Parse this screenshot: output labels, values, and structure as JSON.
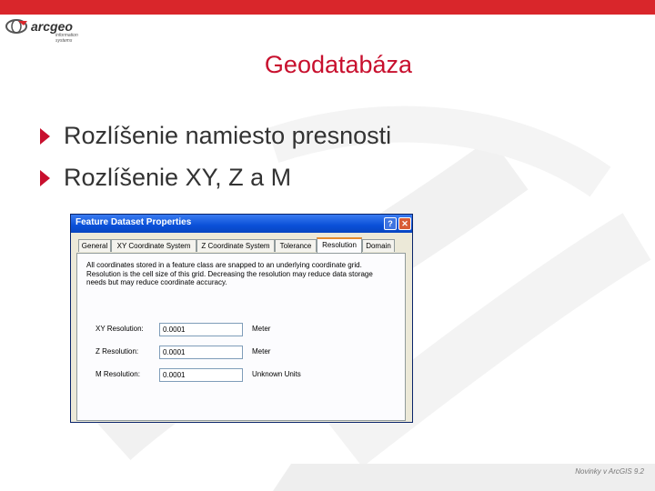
{
  "brand": {
    "name": "arcgeo",
    "tagline": "information systems",
    "accent": "#d9262b",
    "title_color": "#c8102e"
  },
  "slide": {
    "title": "Geodatabáza",
    "bullets": [
      "Rozlíšenie namiesto presnosti",
      "Rozlíšenie XY, Z a M"
    ],
    "footer": "Novinky v ArcGIS 9.2"
  },
  "dialog": {
    "title": "Feature Dataset Properties",
    "help_icon": "question-icon",
    "close_icon": "close-icon",
    "help_glyph": "?",
    "close_glyph": "✕",
    "tabs": [
      "General",
      "XY Coordinate System",
      "Z Coordinate System",
      "Tolerance",
      "Resolution",
      "Domain"
    ],
    "active_tab": "Resolution",
    "description": "All coordinates stored in a feature class are snapped to an underlying coordinate grid. Resolution is the cell size of this grid. Decreasing the resolution may reduce data storage needs but may reduce coordinate accuracy.",
    "resolutions": [
      {
        "label": "XY Resolution:",
        "value": "0.0001",
        "unit": "Meter"
      },
      {
        "label": "Z Resolution:",
        "value": "0.0001",
        "unit": "Meter"
      },
      {
        "label": "M Resolution:",
        "value": "0.0001",
        "unit": "Unknown Units"
      }
    ]
  }
}
